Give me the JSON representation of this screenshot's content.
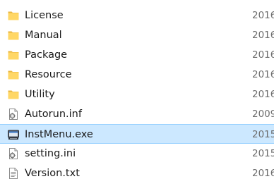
{
  "files": [
    {
      "name": "License",
      "date": "2016",
      "icon": "folder-icon",
      "selected": false
    },
    {
      "name": "Manual",
      "date": "2016",
      "icon": "folder-icon",
      "selected": false
    },
    {
      "name": "Package",
      "date": "2016",
      "icon": "folder-icon",
      "selected": false
    },
    {
      "name": "Resource",
      "date": "2016",
      "icon": "folder-icon",
      "selected": false
    },
    {
      "name": "Utility",
      "date": "2016",
      "icon": "folder-icon",
      "selected": false
    },
    {
      "name": "Autorun.inf",
      "date": "2009",
      "icon": "settings-file-icon",
      "selected": false
    },
    {
      "name": "InstMenu.exe",
      "date": "2015",
      "icon": "application-icon",
      "selected": true
    },
    {
      "name": "setting.ini",
      "date": "2015",
      "icon": "settings-file-icon",
      "selected": false
    },
    {
      "name": "Version.txt",
      "date": "2016",
      "icon": "text-file-icon",
      "selected": false
    }
  ],
  "colors": {
    "folder": "#ffd766",
    "folder_dark": "#e8b640",
    "selection": "#cce8ff",
    "selection_border": "#99d1ff"
  }
}
